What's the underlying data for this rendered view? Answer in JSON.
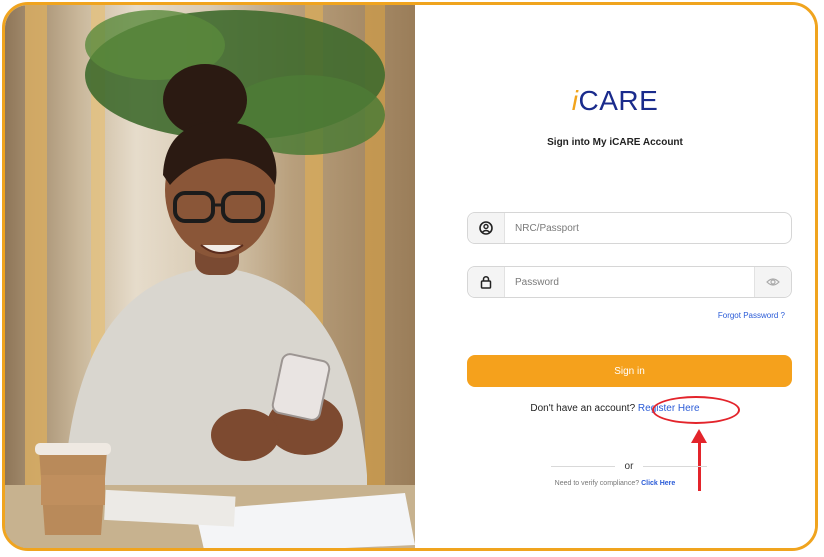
{
  "brand": {
    "prefix": "i",
    "name": "CARE"
  },
  "subtitle": "Sign into My iCARE Account",
  "fields": {
    "id_placeholder": "NRC/Passport",
    "password_placeholder": "Password"
  },
  "links": {
    "forgot": "Forgot Password ?",
    "register_prompt": "Don't have an account?",
    "register": "Register Here",
    "or": "or",
    "verify_prompt": "Need to verify compliance?",
    "verify_link": "Click Here"
  },
  "buttons": {
    "signin": "Sign in"
  },
  "icons": {
    "user": "user-circle-icon",
    "lock": "lock-icon",
    "eye": "eye-icon"
  },
  "colors": {
    "accent": "#f5a11c",
    "brand": "#1a2b8c",
    "link": "#2a5bd7",
    "annotation": "#e3242b"
  }
}
